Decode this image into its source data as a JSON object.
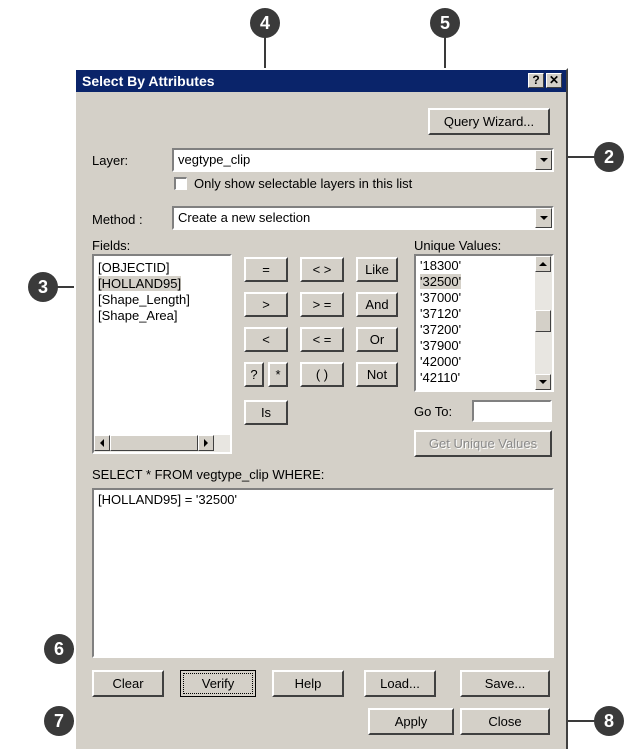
{
  "dialog": {
    "title": "Select By Attributes",
    "help_glyph": "?",
    "close_glyph": "✕",
    "query_wizard": "Query Wizard...",
    "layer_label": "Layer:",
    "layer_value": "vegtype_clip",
    "only_selectable": "Only show selectable layers in this list",
    "method_label": "Method :",
    "method_value": "Create a new selection",
    "fields_label": "Fields:",
    "fields": [
      "[OBJECTID]",
      "[HOLLAND95]",
      "[Shape_Length]",
      "[Shape_Area]"
    ],
    "operators": {
      "eq": "=",
      "ne": "< >",
      "like": "Like",
      "gt": ">",
      "ge": "> =",
      "and": "And",
      "lt": "<",
      "le": "< =",
      "or": "Or",
      "q": "?",
      "star": "*",
      "paren": "( )",
      "not": "Not",
      "is": "Is"
    },
    "unique_values_label": "Unique Values:",
    "unique_values": [
      "'18300'",
      "'32500'",
      "'37000'",
      "'37120'",
      "'37200'",
      "'37900'",
      "'42000'",
      "'42110'"
    ],
    "goto_label": "Go To:",
    "goto_value": "",
    "get_unique": "Get Unique Values",
    "select_label": "SELECT * FROM vegtype_clip WHERE:",
    "expression": "[HOLLAND95] = '32500'",
    "buttons": {
      "clear": "Clear",
      "verify": "Verify",
      "help": "Help",
      "load": "Load...",
      "save": "Save...",
      "apply": "Apply",
      "close": "Close"
    }
  },
  "callouts": [
    "2",
    "3",
    "4",
    "5",
    "6",
    "7",
    "8"
  ]
}
